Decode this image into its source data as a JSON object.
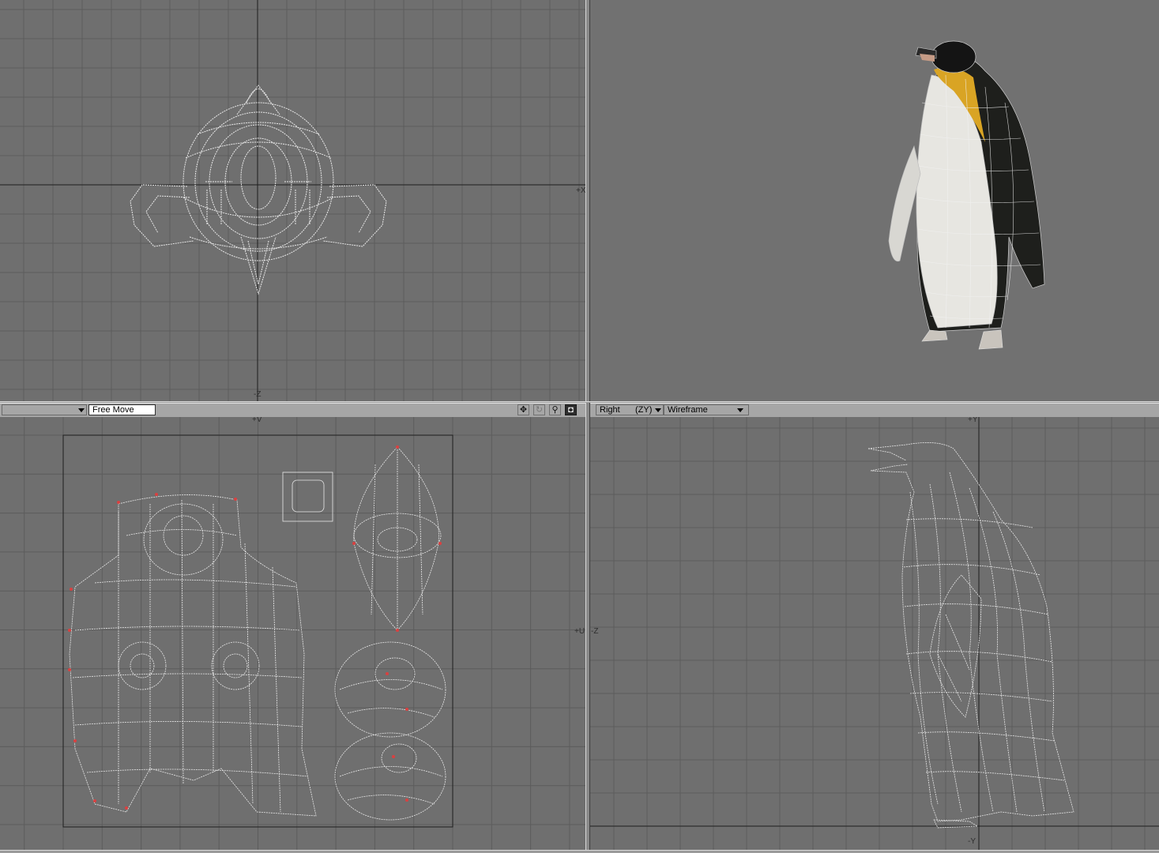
{
  "viewports": {
    "top_left": {
      "axis_x_label": "+X",
      "axis_z_label": "-Z"
    },
    "bottom_left": {
      "mode_label": "",
      "tool_label": "Free Move",
      "axis_v_label": "+V",
      "axis_u_label": "+U",
      "tool_icons": [
        "move-icon",
        "rotate-icon",
        "zoom-icon",
        "maximize-icon"
      ]
    },
    "bottom_right": {
      "view_label": "Right",
      "axes_label": "(ZY)",
      "render_mode_label": "Wireframe",
      "axis_z_label": "-Z",
      "axis_y_top_label": "+Y",
      "axis_y_bottom_label": "-Y"
    }
  },
  "colors": {
    "viewport_bg": "#6f6f6f",
    "grid_line": "#5a5a5a",
    "axis_line": "#1e1e1e",
    "wire": "#e6e6e6",
    "selected_point": "#d94040"
  }
}
